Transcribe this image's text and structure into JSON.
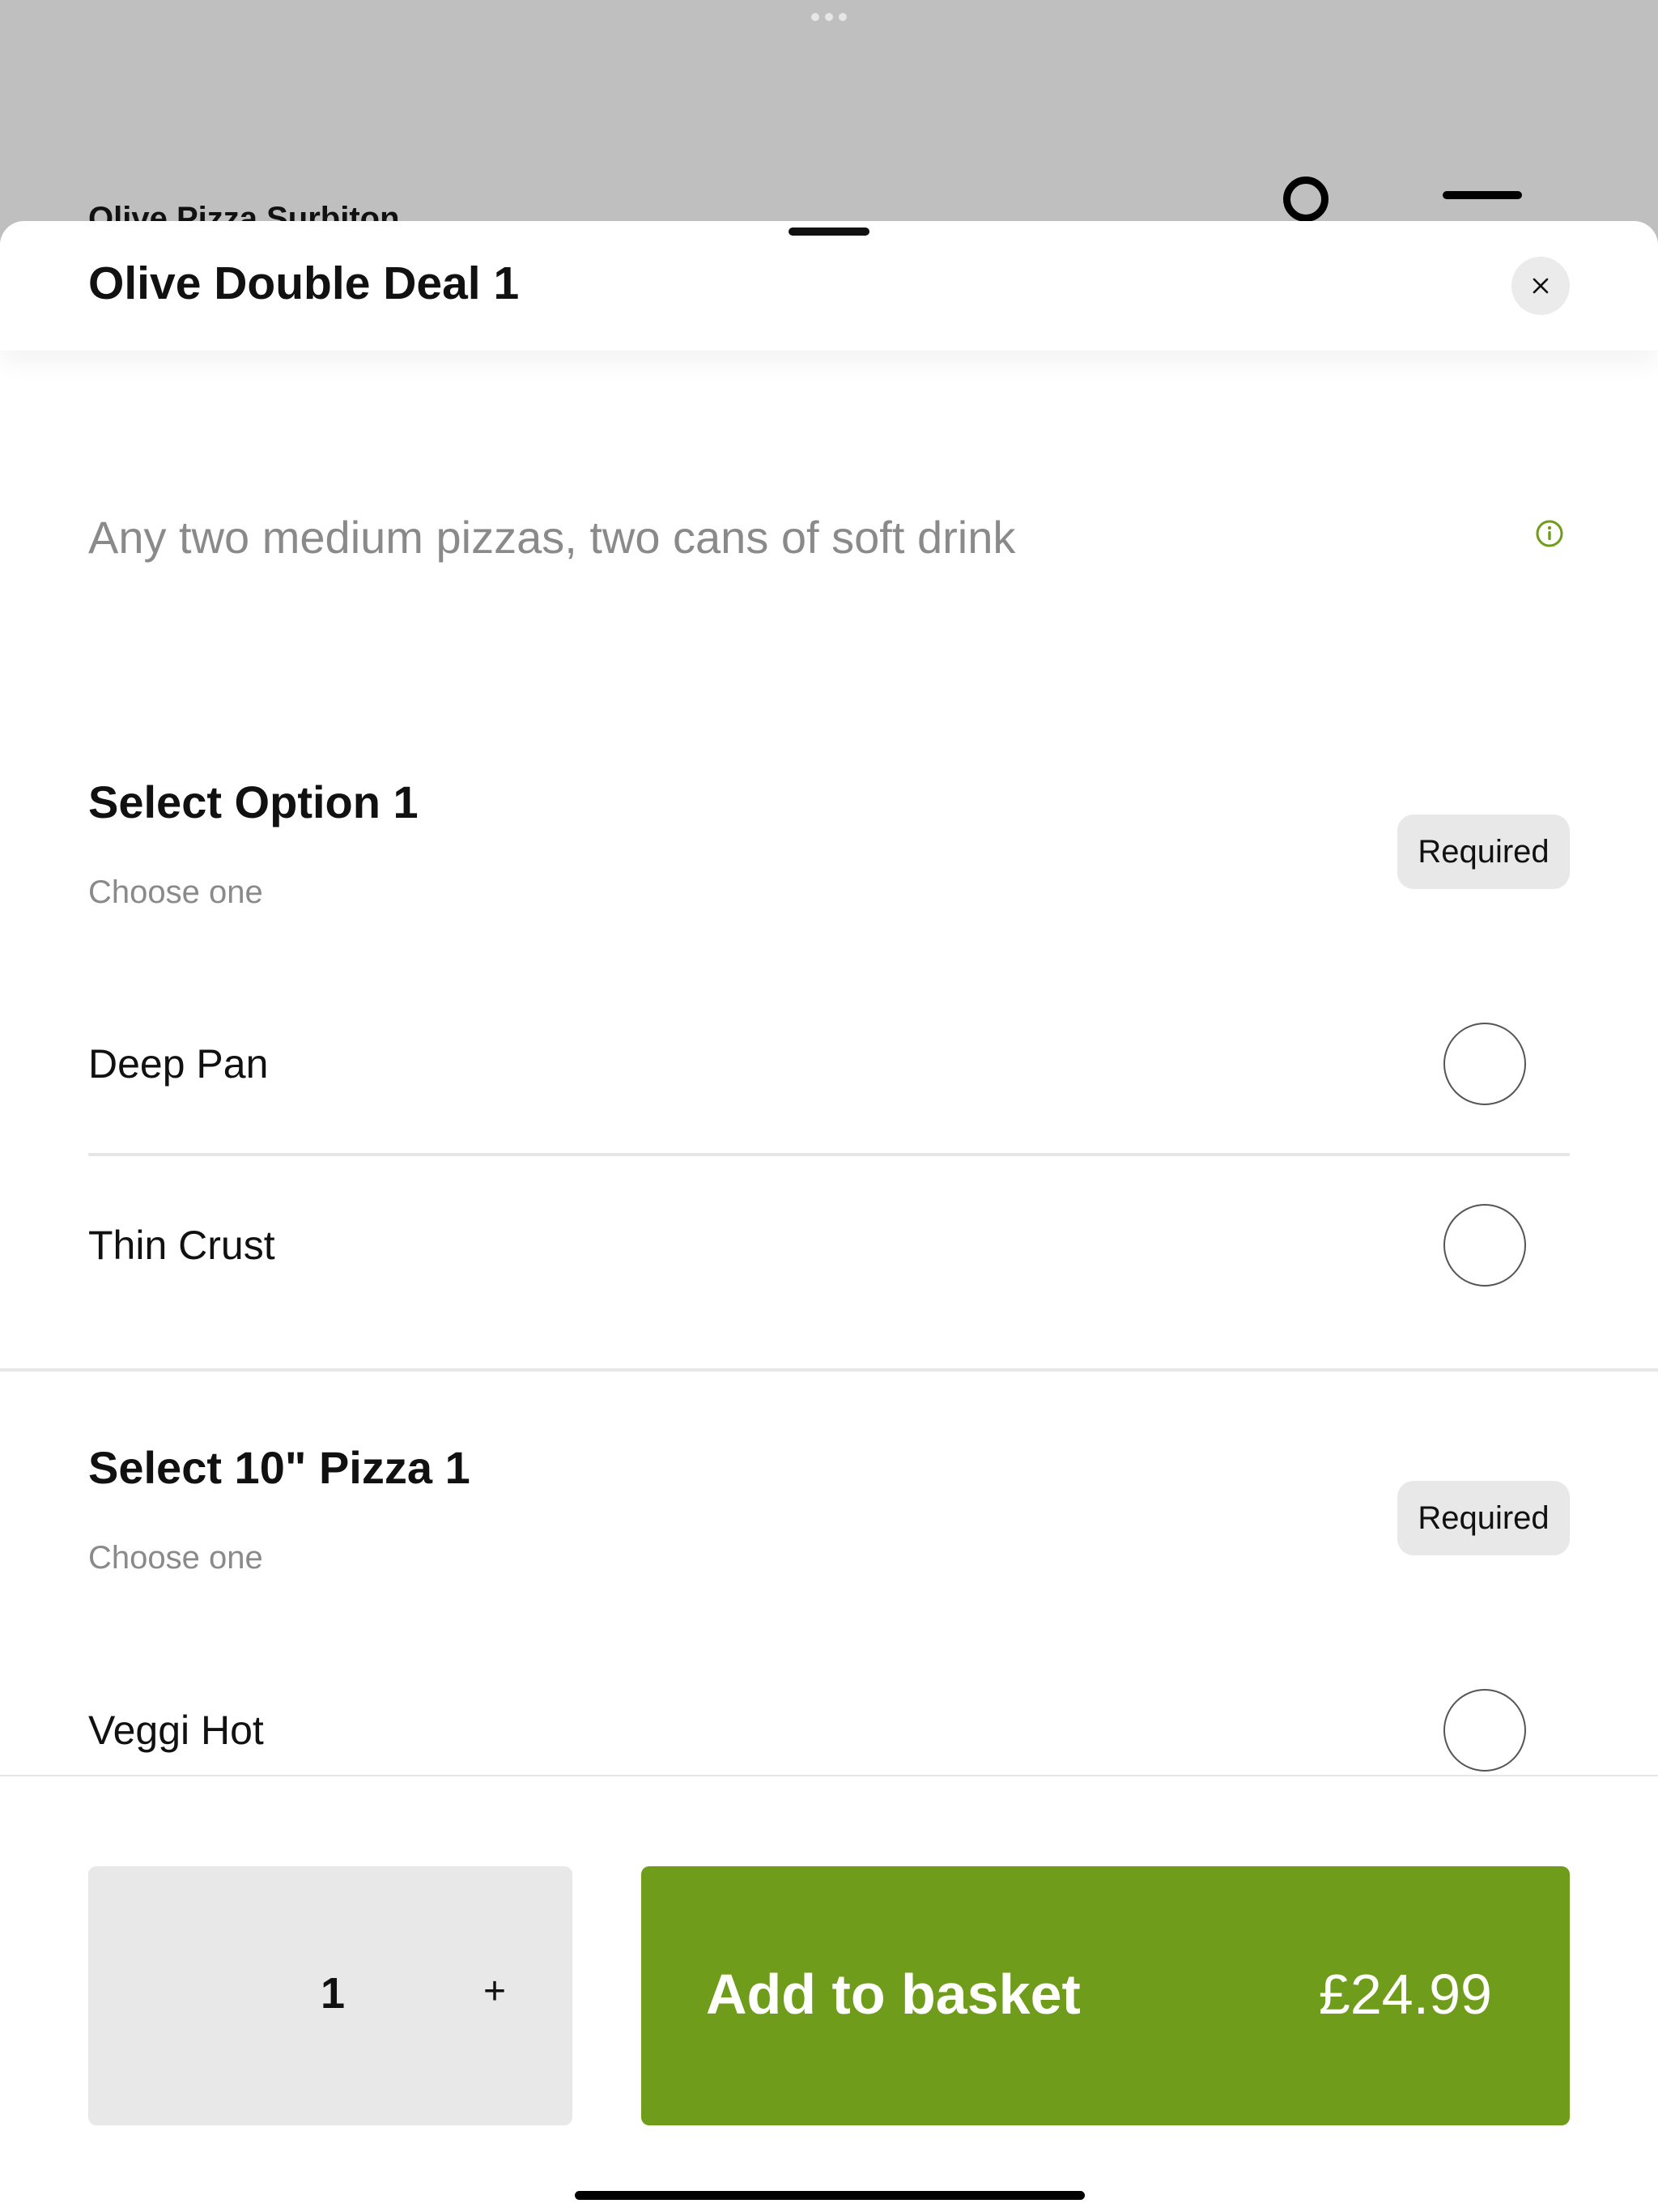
{
  "background": {
    "restaurant_name": "Olive Pizza Surbiton",
    "user_icon": "user-icon",
    "menu_icon": "menu-icon"
  },
  "sheet": {
    "title": "Olive Double Deal 1",
    "close_icon": "close-icon",
    "description": "Any two medium pizzas, two cans of soft drink",
    "info_icon": "info-icon",
    "accent_color": "#6f9c1a"
  },
  "sections": [
    {
      "title": "Select Option 1",
      "subtitle": "Choose one",
      "badge": "Required",
      "options": [
        {
          "label": "Deep Pan",
          "selected": false
        },
        {
          "label": "Thin Crust",
          "selected": false
        }
      ]
    },
    {
      "title": "Select 10\" Pizza 1",
      "subtitle": "Choose one",
      "badge": "Required",
      "options": [
        {
          "label": "Veggi Hot",
          "selected": false
        }
      ]
    }
  ],
  "footer": {
    "quantity": "1",
    "increment_label": "+",
    "add_label": "Add to basket",
    "price": "£24.99"
  }
}
